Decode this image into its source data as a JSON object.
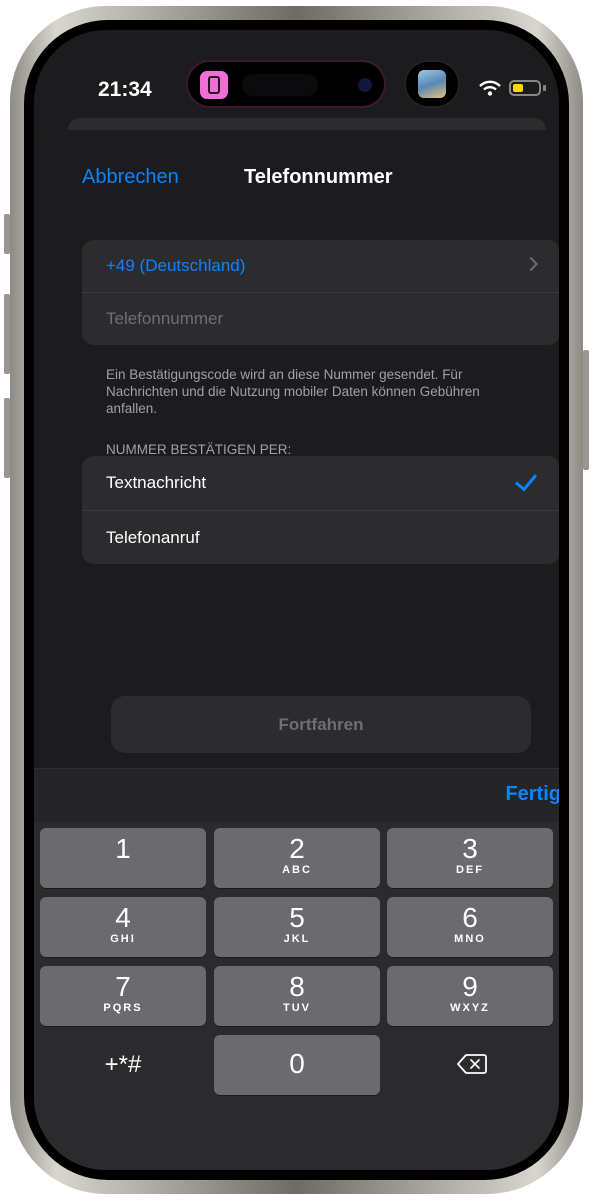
{
  "status": {
    "time": "21:34"
  },
  "nav": {
    "cancel_label": "Abbrechen",
    "title": "Telefonnummer"
  },
  "form": {
    "country_value": "+49 (Deutschland)",
    "phone_placeholder": "Telefonnummer",
    "footnote": "Ein Bestätigungscode wird an diese Nummer gesendet. Für Nachrichten und die Nutzung mobiler Daten können Gebühren anfallen.",
    "verify_section_header": "NUMMER BESTÄTIGEN PER:",
    "options": [
      {
        "label": "Textnachricht",
        "selected": true
      },
      {
        "label": "Telefonanruf",
        "selected": false
      }
    ],
    "continue_label": "Fortfahren"
  },
  "keyboard": {
    "done_label": "Fertig",
    "keys": [
      {
        "num": "1",
        "letters": ""
      },
      {
        "num": "2",
        "letters": "ABC"
      },
      {
        "num": "3",
        "letters": "DEF"
      },
      {
        "num": "4",
        "letters": "GHI"
      },
      {
        "num": "5",
        "letters": "JKL"
      },
      {
        "num": "6",
        "letters": "MNO"
      },
      {
        "num": "7",
        "letters": "PQRS"
      },
      {
        "num": "8",
        "letters": "TUV"
      },
      {
        "num": "9",
        "letters": "WXYZ"
      },
      {
        "num": "0",
        "letters": ""
      }
    ],
    "symbols_label": "+*#"
  },
  "colors": {
    "accent": "#0a84ff",
    "background": "#1c1c1e",
    "card": "#2c2c2e",
    "key": "#6b6b6f"
  },
  "icons": [
    "phone-app-icon",
    "wifi-icon",
    "battery-icon",
    "chevron-right-icon",
    "checkmark-icon",
    "delete-backspace-icon"
  ]
}
